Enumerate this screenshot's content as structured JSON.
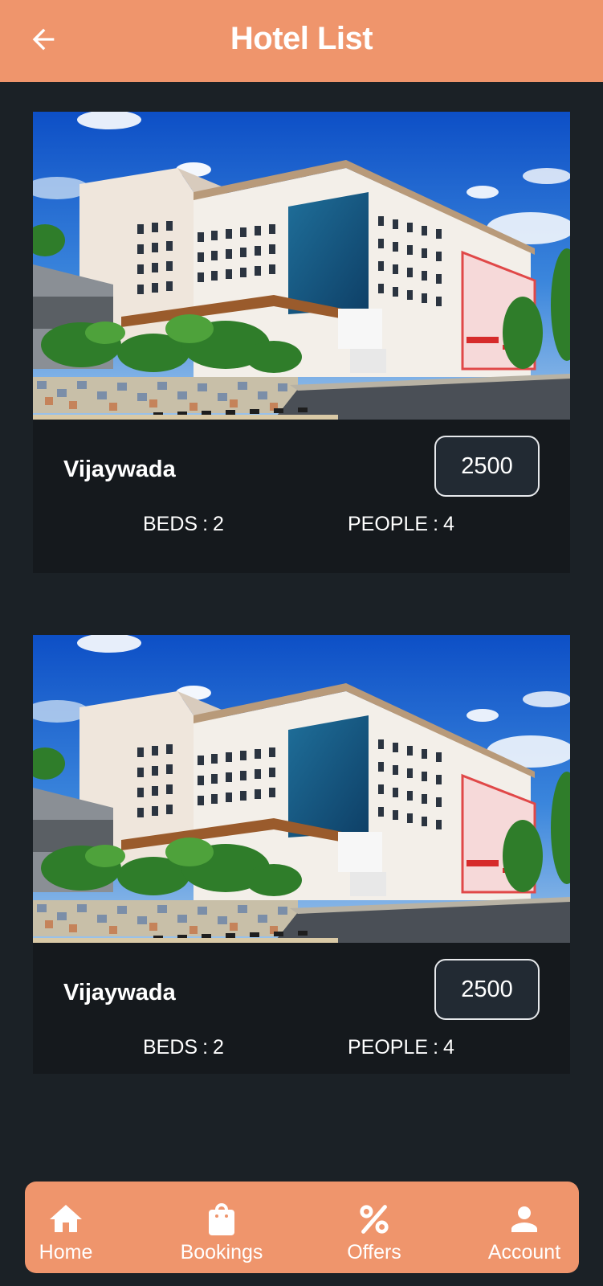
{
  "header": {
    "title": "Hotel List",
    "back_icon": "arrow-left-icon"
  },
  "hotels": [
    {
      "name": "Vijaywada",
      "price": "2500",
      "beds_label": "BEDS",
      "beds": "2",
      "people_label": "PEOPLE",
      "people": "4",
      "separator": ":",
      "image": "hotel-building-photo"
    },
    {
      "name": "Vijaywada",
      "price": "2500",
      "beds_label": "BEDS",
      "beds": "2",
      "people_label": "PEOPLE",
      "people": "4",
      "separator": ":",
      "image": "hotel-building-photo"
    }
  ],
  "bottom_nav": {
    "items": [
      {
        "label": "Home",
        "icon": "home-icon"
      },
      {
        "label": "Bookings",
        "icon": "shopping-bag-icon"
      },
      {
        "label": "Offers",
        "icon": "percent-icon"
      },
      {
        "label": "Account",
        "icon": "person-icon"
      }
    ]
  },
  "colors": {
    "accent": "#ef956c",
    "background": "#1b2126",
    "card": "#15191d",
    "price_box": "#222a33"
  }
}
